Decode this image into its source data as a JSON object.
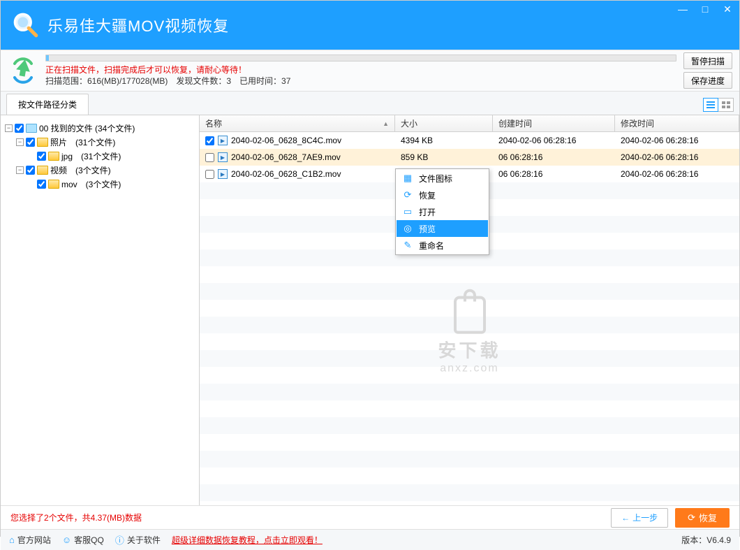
{
  "app": {
    "title": "乐易佳大疆MOV视频恢复"
  },
  "window": {
    "minimize": "—",
    "maximize": "□",
    "close": "✕"
  },
  "scan": {
    "status": "正在扫描文件，扫描完成后才可以恢复，请耐心等待！",
    "range": "扫描范围：616(MB)/177028(MB)　发现文件数：3　已用时间：37",
    "pause_btn": "暂停扫描",
    "save_btn": "保存进度"
  },
  "tabs": {
    "primary": "按文件路径分类"
  },
  "tree": {
    "root": "00 找到的文件  (34个文件)",
    "photo": "照片　(31个文件)",
    "jpg": "jpg　(31个文件)",
    "video": "视频　(3个文件)",
    "mov": "mov　(3个文件)"
  },
  "columns": {
    "name": "名称",
    "size": "大小",
    "ctime": "创建时间",
    "mtime": "修改时间"
  },
  "files": [
    {
      "name": "2040-02-06_0628_8C4C.mov",
      "size": "4394 KB",
      "ctime": "2040-02-06  06:28:16",
      "mtime": "2040-02-06  06:28:16",
      "checked": true,
      "selected": false
    },
    {
      "name": "2040-02-06_0628_7AE9.mov",
      "size": "859 KB",
      "ctime": "06  06:28:16",
      "mtime": "2040-02-06  06:28:16",
      "checked": false,
      "selected": true
    },
    {
      "name": "2040-02-06_0628_C1B2.mov",
      "size": "",
      "ctime": "06  06:28:16",
      "mtime": "2040-02-06  06:28:16",
      "checked": false,
      "selected": false
    }
  ],
  "context_menu": {
    "icon_view": "文件图标",
    "recover": "恢复",
    "open": "打开",
    "preview": "预览",
    "rename": "重命名"
  },
  "watermark": {
    "line1": "安下载",
    "line2": "anxz.com"
  },
  "bottom": {
    "selection": "您选择了2个文件，共4.37(MB)数据",
    "prev": "上一步",
    "recover": "恢复"
  },
  "footer": {
    "site": "官方网站",
    "qq": "客服QQ",
    "about": "关于软件",
    "tutorial": "超级详细数据恢复教程，点击立即观看！",
    "version": "版本：V6.4.9"
  }
}
